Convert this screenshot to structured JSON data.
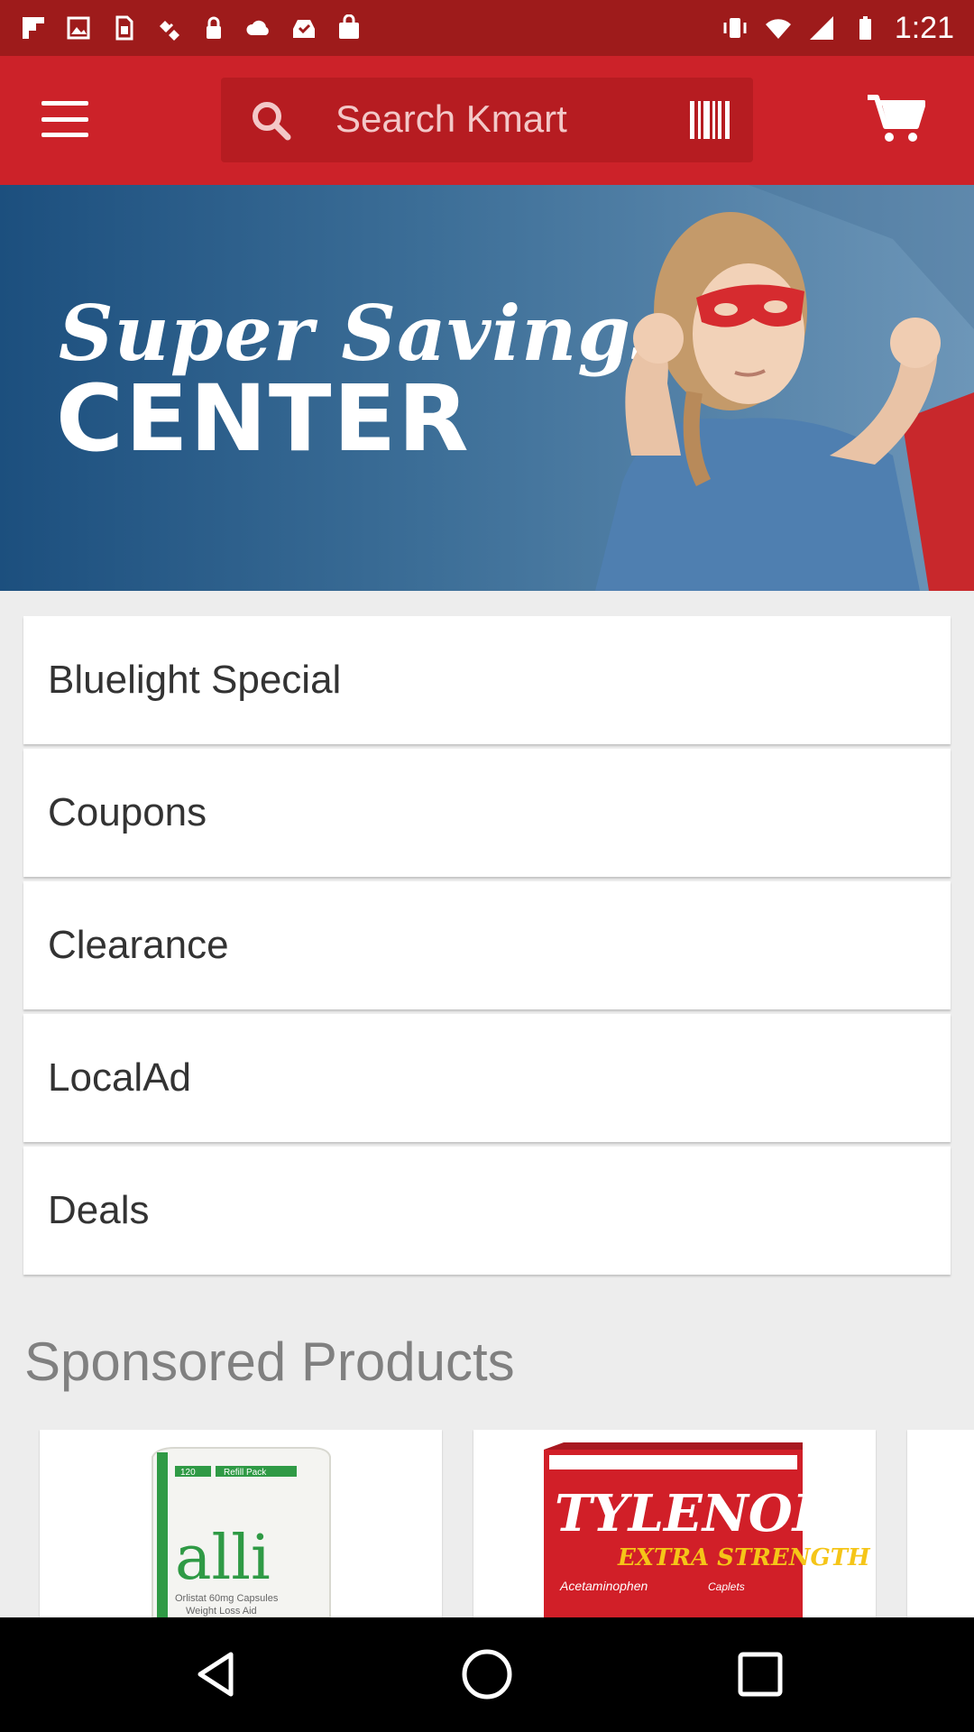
{
  "status_bar": {
    "time": "1:21",
    "icons": [
      "flipboard-icon",
      "image-icon",
      "sim-card-icon",
      "satellite-icon",
      "lock-icon",
      "cloud-icon",
      "inbox-check-icon",
      "shopping-bag-icon",
      "vibrate-icon",
      "wifi-icon",
      "signal-icon",
      "battery-icon"
    ]
  },
  "app_bar": {
    "search_placeholder": "Search Kmart",
    "brand_color": "#cc2229"
  },
  "banner": {
    "line1": "Super Savings",
    "line2": "CENTER"
  },
  "menu": {
    "items": [
      {
        "label": "Bluelight Special"
      },
      {
        "label": "Coupons"
      },
      {
        "label": "Clearance"
      },
      {
        "label": "LocalAd"
      },
      {
        "label": "Deals"
      }
    ]
  },
  "sponsored": {
    "heading": "Sponsored Products",
    "products": [
      {
        "brand": "alli",
        "badge": "Refill Pack",
        "count": "120",
        "detail": "Orlistat 60mg Capsules",
        "subdetail": "Weight Loss Aid"
      },
      {
        "brand": "TYLENOL",
        "line": "EXTRA STRENGTH",
        "detail": "Acetaminophen",
        "form": "Caplets"
      }
    ]
  }
}
